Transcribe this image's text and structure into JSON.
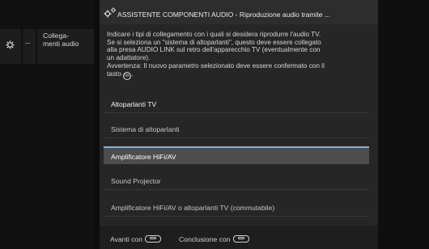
{
  "breadcrumb": {
    "ellipsis": "...",
    "current_line1": "Collega-",
    "current_line2": "menti audio"
  },
  "dialog": {
    "title": "ASSISTENTE COMPONENTI AUDIO - Riproduzione audio tramite ...",
    "info_line1": "Indicare i tipi di collegamento con i quali si desidera riprodurre l'audio TV.",
    "info_line2": "Se si seleziona un \"sistema di altoparlanti\", questo deve essere collegato",
    "info_line3": "alla presa AUDIO LINK sul retro dell'apparecchio TV (eventualmente con",
    "info_line4": "un adattatore).",
    "info_line5": "Avvertenza: Il nuovo parametro selezionato deve essere confermato con il",
    "info_line6": "tasto",
    "info_line6_end": ".",
    "ok_symbol": "OK",
    "options": [
      {
        "label": "Altoparlanti TV"
      },
      {
        "label": "Sistema di altoparlanti"
      },
      {
        "label": "Amplificatore HiFi/AV"
      },
      {
        "label": "Sound Projector"
      },
      {
        "label": "Amplificatore HiFi/AV o altoparlanti TV (commutabile)"
      }
    ],
    "selected_index": 2
  },
  "footer": {
    "next_label": "Avanti con",
    "finish_label": "Conclusione con"
  },
  "colors": {
    "accent": "#7db3d8",
    "selected_bg": "#4d4d4d",
    "panel_bg": "#262626"
  },
  "icons": [
    "gear-icon",
    "gear-pair-icon",
    "right-button-icon",
    "end-button-icon"
  ]
}
